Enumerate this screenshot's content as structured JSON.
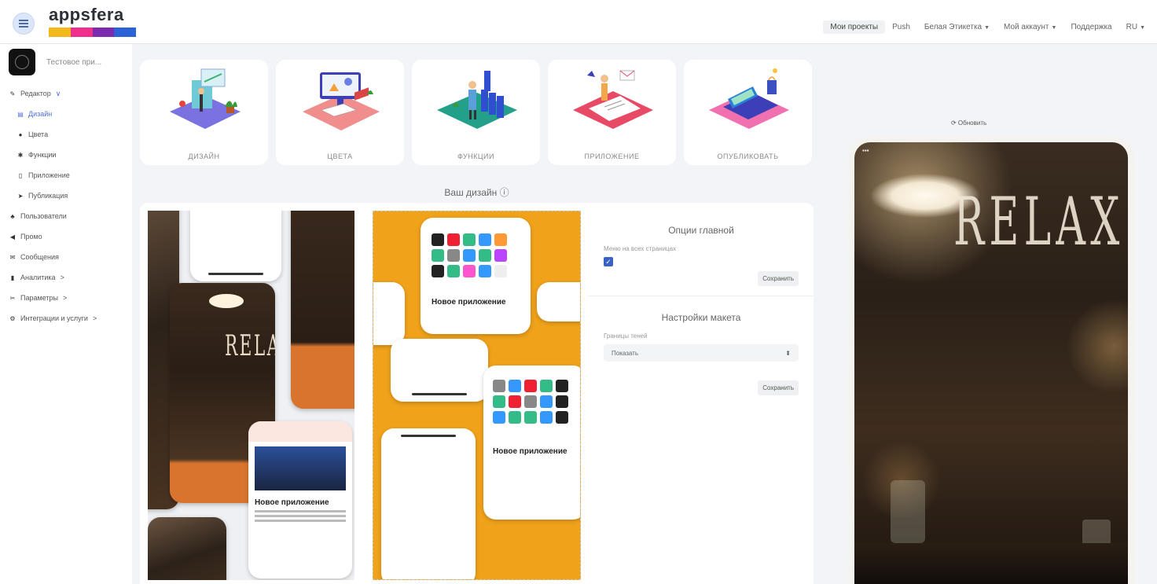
{
  "app": {
    "logo_text": "appsfera",
    "logo_colors": [
      "#f2b81c",
      "#ee2f8b",
      "#7b2bb0",
      "#2c62d8"
    ]
  },
  "topnav": {
    "items": [
      {
        "label": "Мои проекты",
        "active": true,
        "dropdown": false
      },
      {
        "label": "Push",
        "active": false,
        "dropdown": false
      },
      {
        "label": "Белая Этикетка",
        "active": false,
        "dropdown": true
      },
      {
        "label": "Мой аккаунт",
        "active": false,
        "dropdown": true
      },
      {
        "label": "Поддержка",
        "active": false,
        "dropdown": false
      },
      {
        "label": "RU",
        "active": false,
        "dropdown": true
      }
    ]
  },
  "sidebar": {
    "app_name": "Тестовое при...",
    "items": [
      {
        "label": "Редактор",
        "icon": "pencil-icon",
        "suffix": "∨"
      },
      {
        "label": "Дизайн",
        "icon": "layout-icon",
        "sub": true,
        "active": true
      },
      {
        "label": "Цвета",
        "icon": "palette-icon",
        "sub": true
      },
      {
        "label": "Функции",
        "icon": "gear-icon",
        "sub": true
      },
      {
        "label": "Приложение",
        "icon": "phone-icon",
        "sub": true
      },
      {
        "label": "Публикация",
        "icon": "send-icon",
        "sub": true
      },
      {
        "label": "Пользователи",
        "icon": "users-icon"
      },
      {
        "label": "Промо",
        "icon": "megaphone-icon"
      },
      {
        "label": "Сообщения",
        "icon": "envelope-icon"
      },
      {
        "label": "Аналитика",
        "icon": "chart-icon",
        "suffix": ">"
      },
      {
        "label": "Параметры",
        "icon": "tool-icon",
        "suffix": ">"
      },
      {
        "label": "Интеграции и услуги",
        "icon": "cogs-icon",
        "suffix": ">"
      }
    ]
  },
  "steps": [
    {
      "label": "ДИЗАЙН"
    },
    {
      "label": "ЦВЕТА"
    },
    {
      "label": "ФУНКЦИИ"
    },
    {
      "label": "ПРИЛОЖЕНИЕ"
    },
    {
      "label": "ОПУБЛИКОВАТЬ"
    }
  ],
  "main": {
    "design_title": "Ваш дизайн ⓘ"
  },
  "home_options": {
    "title": "Опции главной",
    "menu_label": "Меню на всех страницах",
    "menu_checked": true,
    "save_label": "Сохранить"
  },
  "layout_settings": {
    "title": "Настройки макета",
    "shadow_label": "Границы теней",
    "shadow_value": "Показать",
    "save_label": "Сохранить"
  },
  "preview": {
    "refresh_label": "⟳ Обновить",
    "relax_text": "RELAX"
  },
  "templates": {
    "sample_heading": "Новое приложение"
  }
}
